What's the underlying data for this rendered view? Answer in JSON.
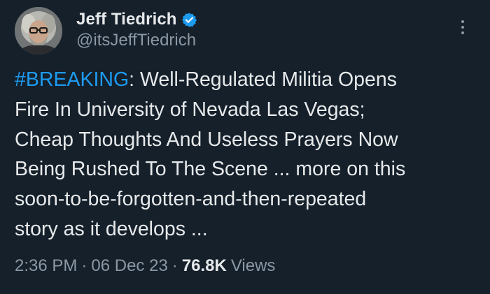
{
  "author": {
    "display_name": "Jeff Tiedrich",
    "handle": "@itsJeffTiedrich",
    "verified": true
  },
  "tweet": {
    "hashtag": "#BREAKING",
    "lines": [
      ": Well-Regulated Militia Opens",
      "Fire In University of Nevada Las Vegas;",
      "Cheap Thoughts And Useless Prayers Now",
      "Being Rushed To The Scene ... more on this",
      "soon-to-be-forgotten-and-then-repeated",
      "story as it develops ..."
    ]
  },
  "meta": {
    "time": "2:36 PM",
    "separator": "·",
    "date": "06 Dec 23",
    "views_count": "76.8K",
    "views_label": "Views"
  },
  "icons": {
    "verified": "verified-badge-icon",
    "more": "more-options-icon"
  },
  "colors": {
    "background": "#15202b",
    "text": "#e7e9ea",
    "secondary_text": "#8b98a5",
    "accent": "#1d9bf0"
  }
}
